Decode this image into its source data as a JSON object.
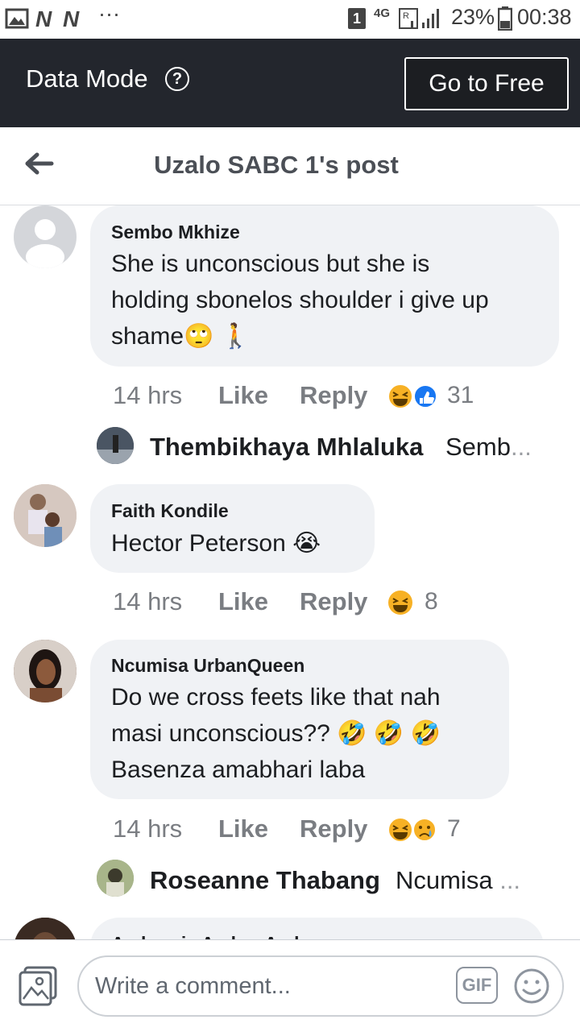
{
  "status_bar": {
    "network": "4G",
    "sim_slot": "1",
    "battery": "23%",
    "time": "00:38",
    "dots": "···"
  },
  "data_mode": {
    "label": "Data Mode",
    "help_glyph": "?",
    "go_free_label": "Go to Free"
  },
  "header": {
    "title": "Uzalo SABC 1's post"
  },
  "comments": [
    {
      "author": "Sembo Mkhize",
      "lines": [
        "She is unconscious but she is",
        "holding sbonelos shoulder i give up",
        "shame🙄 🚶"
      ],
      "time": "14 hrs",
      "like_label": "Like",
      "reply_label": "Reply",
      "reactions": [
        "haha",
        "like"
      ],
      "reaction_count": "31",
      "reply": {
        "author": "Thembikhaya Mhlaluka",
        "preview": "Semb",
        "ellipsis": "..."
      }
    },
    {
      "author": "Faith Kondile",
      "lines": [
        "Hector Peterson 😭"
      ],
      "time": "14 hrs",
      "like_label": "Like",
      "reply_label": "Reply",
      "reactions": [
        "haha"
      ],
      "reaction_count": "8"
    },
    {
      "author": "Ncumisa UrbanQueen",
      "lines": [
        "Do we cross feets like that nah",
        "masi unconscious?? 🤣 🤣 🤣",
        "Basenza amabhari laba"
      ],
      "time": "14 hrs",
      "like_label": "Like",
      "reply_label": "Reply",
      "reactions": [
        "haha",
        "sad"
      ],
      "reaction_count": "7",
      "reply": {
        "author": "Roseanne Thabang",
        "preview": "Ncumisa",
        "ellipsis": " ..."
      }
    },
    {
      "author": "Ambrosia Amber Ambr",
      "lines": []
    }
  ],
  "composer": {
    "placeholder": "Write a comment...",
    "gif_label": "GIF"
  },
  "colors": {
    "data_bar": "#23262d",
    "bubble": "#f0f2f5",
    "meta": "#7a7d82",
    "like_blue": "#1877f2",
    "haha_yellow": "#f7b125"
  }
}
